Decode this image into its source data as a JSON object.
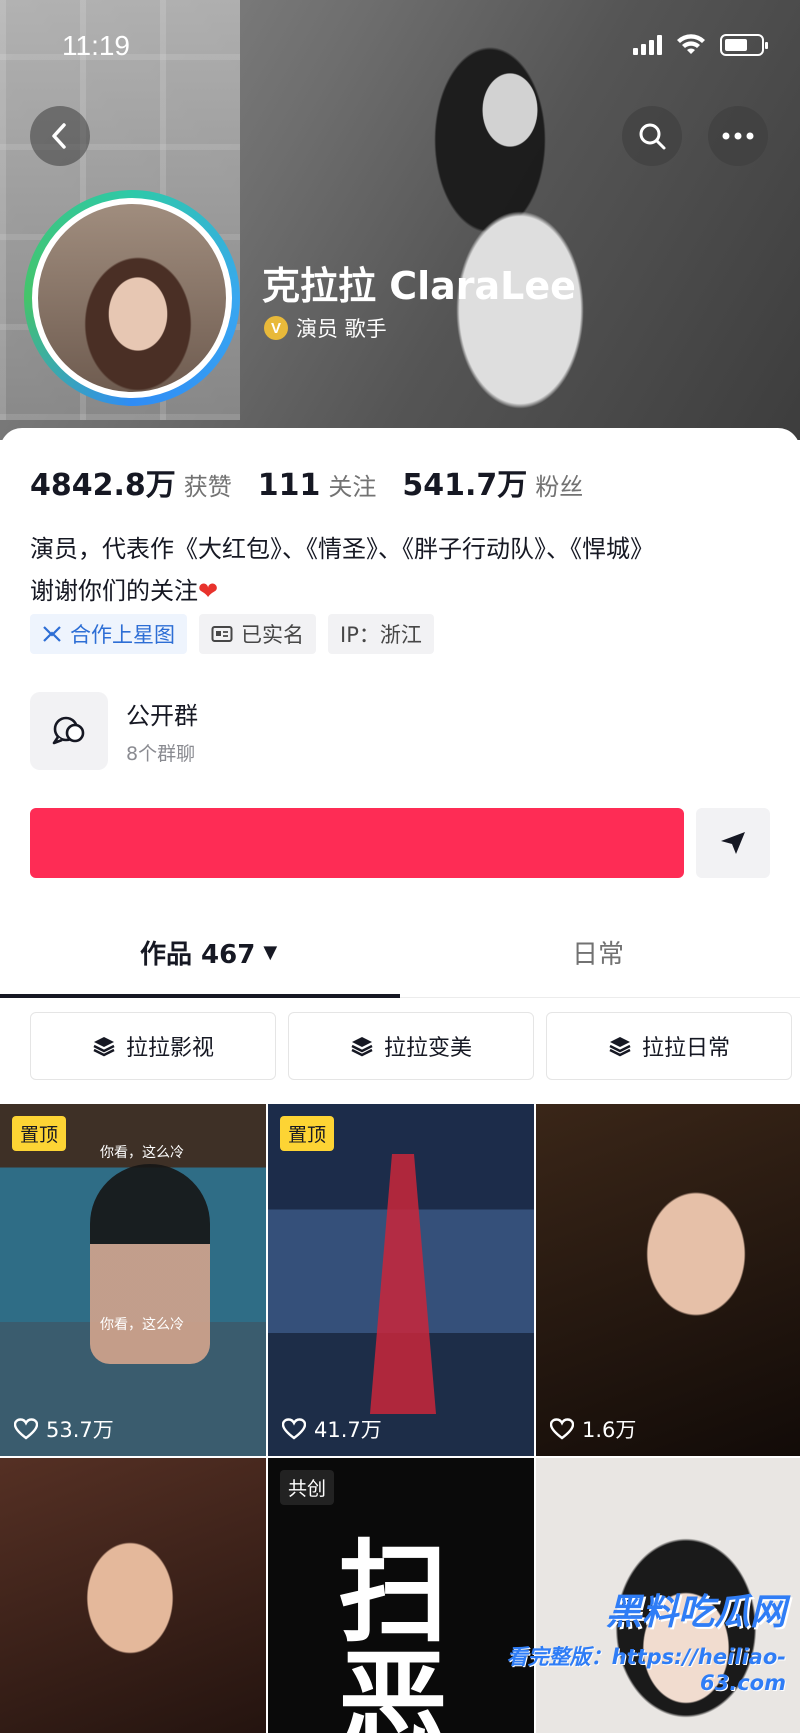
{
  "status": {
    "time": "11:19"
  },
  "profile": {
    "name": "克拉拉 ClaraLee",
    "badge": "V",
    "tags": "演员 歌手"
  },
  "stats": [
    {
      "num": "4842.8万",
      "label": "获赞"
    },
    {
      "num": "111",
      "label": "关注"
    },
    {
      "num": "541.7万",
      "label": "粉丝"
    }
  ],
  "bio": {
    "line1": "演员，代表作《大红包》、《情圣》、《胖子行动队》、《悍城》",
    "line2": "谢谢你们的关注",
    "heart": "❤"
  },
  "chips": [
    {
      "label": "合作上星图",
      "icon": "star-map-icon"
    },
    {
      "label": "已实名",
      "icon": "id-card-icon"
    },
    {
      "label": "IP：浙江"
    }
  ],
  "group": {
    "title": "公开群",
    "sub": "8个群聊",
    "icon": "chat-bubbles-icon"
  },
  "colors": {
    "follow": "#fe2c55",
    "accent": "#2d6ed5",
    "pin": "#fdd434"
  },
  "tabs": {
    "works": "作品 467",
    "works_arrow": "▼",
    "daily": "日常"
  },
  "collections": [
    "拉拉影视",
    "拉拉变美",
    "拉拉日常"
  ],
  "videos": [
    {
      "badge": "置顶",
      "likes": "53.7万",
      "caption": "你看，这么冷"
    },
    {
      "badge": "置顶",
      "likes": "41.7万"
    },
    {
      "likes": "1.6万"
    },
    {},
    {
      "badge": "共创",
      "title_art": "扫恶"
    },
    {}
  ],
  "watermark": {
    "title": "黑料吃瓜网",
    "url": "看完整版：https://heiliao-63.com"
  }
}
